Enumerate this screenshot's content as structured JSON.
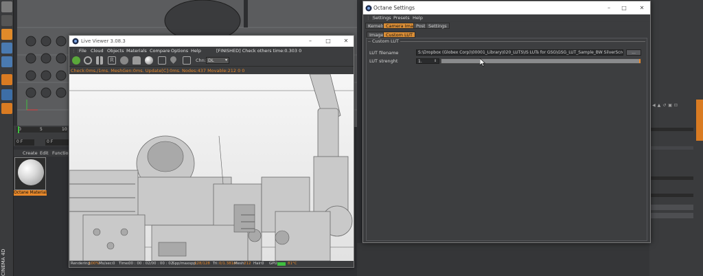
{
  "background": {
    "material_manager": {
      "menu": [
        "Create",
        "Edit",
        "Function"
      ],
      "material_label": "Octane Material"
    },
    "timeline": {
      "ticks": [
        "0",
        "5",
        "10"
      ],
      "frame_start": "0 F",
      "frame_current": "0 F"
    },
    "app_logo_text": "CINEMA 4D"
  },
  "live_viewer": {
    "title": "Live Viewer 3.08.3",
    "menu": [
      "File",
      "Cloud",
      "Objects",
      "Materials",
      "Compare",
      "Options",
      "Help"
    ],
    "menu_status": "[FINISHED] Check others time:0.303  0",
    "channel_label": "Chn:",
    "channel_value": "DL",
    "status_line": "Check:0ms./1ms. MeshGen:0ms. Update[C]:0ms. Nodes:437 Movable:212  0 0",
    "footer": {
      "rendering_label": "Rendering:",
      "rendering_value": "100%",
      "mssec_label": "Ms/sec:",
      "mssec_value": "0",
      "time_label": "Time:",
      "time_value": "00 : 00 : 02/00 : 00 : 02",
      "spp_label": "Spp/maxspp:",
      "spp_value": "128/128",
      "tri_label": "Tri:",
      "tri_value": "0/1.381m",
      "mesh_label": "Mesh:",
      "mesh_value": "212",
      "hair_label": "Hair:",
      "hair_value": "0",
      "gpu_label": "GPU:",
      "gpu_temp": "81°C"
    }
  },
  "octane_settings": {
    "title": "Octane Settings",
    "menu": [
      "Settings",
      "Presets",
      "Help"
    ],
    "tabs": [
      "Kernels",
      "Camera Imager",
      "Post",
      "Settings"
    ],
    "active_tab": "Camera Imager",
    "subtabs": [
      "Imager",
      "Custom LUT"
    ],
    "active_subtab": "Custom LUT",
    "group_title": "Custom LUT",
    "lut_filename_label": "LUT filename",
    "lut_filename_value": "S:\\Dropbox (Globex Corp)\\00001_Library\\020_LUTS\\IS LUTs for GSG\\GSG_LUT_Sample_BW SilverScreen.cube",
    "browse_label": "...",
    "lut_strength_label": "LUT strenght",
    "lut_strength_value": "1.",
    "lut_strength_fraction": 1.0
  },
  "colors": {
    "accent": "#d98d36",
    "status_text": "#e8882a",
    "panel_bg": "#3b3c3e"
  }
}
